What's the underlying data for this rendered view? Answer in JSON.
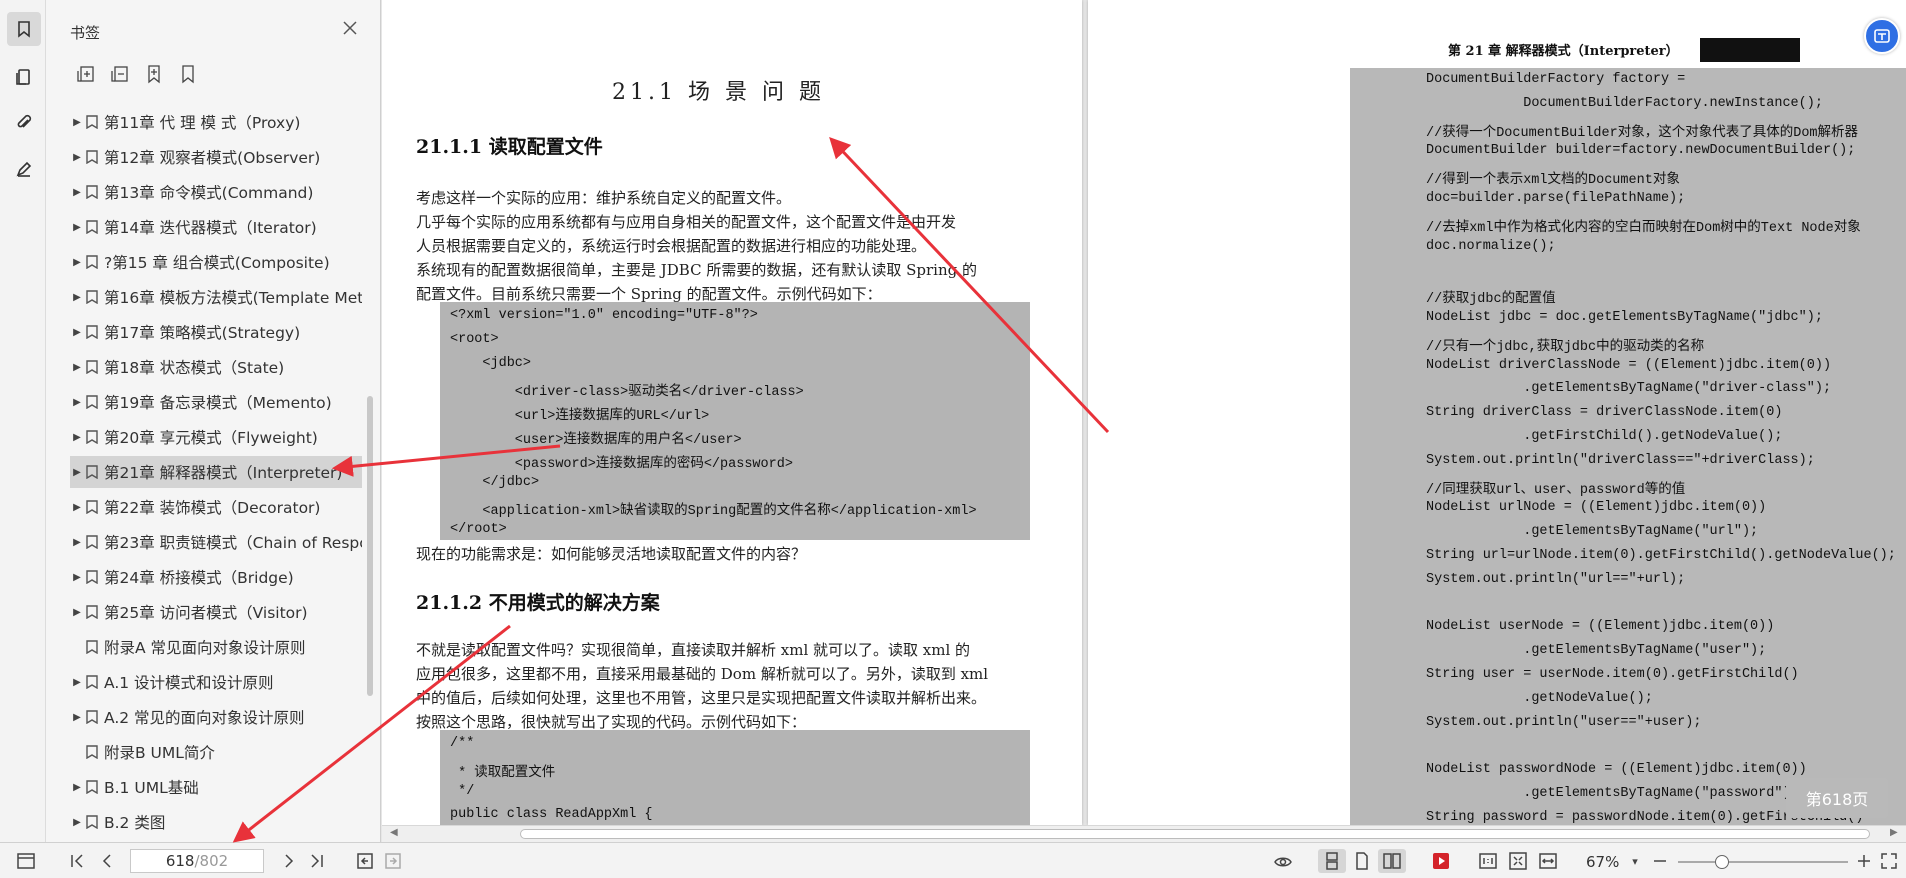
{
  "panel": {
    "title": "书签",
    "bookmarks": [
      {
        "label": "第11章 代 理 模 式（Proxy)",
        "expandable": true
      },
      {
        "label": "第12章 观察者模式(Observer)",
        "expandable": true
      },
      {
        "label": "第13章 命令模式(Command)",
        "expandable": true
      },
      {
        "label": "第14章 迭代器模式（Iterator)",
        "expandable": true
      },
      {
        "label": "?第15 章 组合模式(Composite)",
        "expandable": true
      },
      {
        "label": "第16章 模板方法模式(Template Met",
        "expandable": true
      },
      {
        "label": "第17章 策略模式(Strategy)",
        "expandable": true
      },
      {
        "label": "第18章 状态模式（State)",
        "expandable": true
      },
      {
        "label": "第19章 备忘录模式（Memento)",
        "expandable": true
      },
      {
        "label": "第20章 享元模式（Flyweight)",
        "expandable": true
      },
      {
        "label": "第21章 解释器模式（Interpreter)",
        "expandable": true,
        "selected": true
      },
      {
        "label": "第22章 装饰模式（Decorator)",
        "expandable": true
      },
      {
        "label": "第23章 职责链模式（Chain of Respc",
        "expandable": true
      },
      {
        "label": "第24章 桥接模式（Bridge)",
        "expandable": true
      },
      {
        "label": "第25章 访问者模式（Visitor)",
        "expandable": true
      },
      {
        "label": "附录A 常见面向对象设计原则",
        "expandable": false
      },
      {
        "label": "A.1 设计模式和设计原则",
        "expandable": true
      },
      {
        "label": "A.2 常见的面向对象设计原则",
        "expandable": true
      },
      {
        "label": "附录B UML简介",
        "expandable": false
      },
      {
        "label": "B.1 UML基础",
        "expandable": true
      },
      {
        "label": "B.2 类图",
        "expandable": true
      }
    ]
  },
  "left_page": {
    "section_title": "21.1  场 景 问 题",
    "sub1": "21.1.1   读取配置文件",
    "paras1": [
      "    考虑这样一个实际的应用：维护系统自定义的配置文件。",
      "    几乎每个实际的应用系统都有与应用自身相关的配置文件，这个配置文件是由开发",
      "人员根据需要自定义的，系统运行时会根据配置的数据进行相应的功能处理。",
      "    系统现有的配置数据很简单，主要是 JDBC 所需要的数据，还有默认读取 Spring 的",
      "配置文件。目前系统只需要一个 Spring 的配置文件。示例代码如下："
    ],
    "code1": [
      "<?xml version=\"1.0\" encoding=\"UTF-8\"?>",
      "<root>",
      "    <jdbc>",
      "        <driver-class>驱动类名</driver-class>",
      "        <url>连接数据库的URL</url>",
      "        <user>连接数据库的用户名</user>",
      "        <password>连接数据库的密码</password>",
      "    </jdbc>",
      "    <application-xml>缺省读取的Spring配置的文件名称</application-xml>",
      "</root>"
    ],
    "para_after_code1": "    现在的功能需求是：如何能够灵活地读取配置文件的内容？",
    "sub2": "21.1.2   不用模式的解决方案",
    "paras2": [
      "    不就是读取配置文件吗？实现很简单，直接读取并解析 xml 就可以了。读取 xml 的",
      "应用包很多，这里都不用，直接采用最基础的  Dom  解析就可以了。另外，读取到  xml",
      "中的值后，后续如何处理，这里也不用管，这里只是实现把配置文件读取并解析出来。",
      "    按照这个思路，很快就写出了实现的代码。示例代码如下："
    ],
    "code2": [
      "/**",
      " * 读取配置文件",
      " */",
      "public class ReadAppXml {"
    ]
  },
  "right_page": {
    "header": "第 21 章   解释器模式（Interpreter）",
    "code": [
      "DocumentBuilderFactory factory =",
      "            DocumentBuilderFactory.newInstance();",
      "//获得一个DocumentBuilder对象，这个对象代表了具体的Dom解析器",
      "DocumentBuilder builder=factory.newDocumentBuilder();",
      "//得到一个表示xml文档的Document对象",
      "doc=builder.parse(filePathName);",
      "//去掉xml中作为格式化内容的空白而映射在Dom树中的Text Node对象",
      "doc.normalize();",
      "",
      "//获取jdbc的配置值",
      "NodeList jdbc = doc.getElementsByTagName(\"jdbc\");",
      "//只有一个jdbc,获取jdbc中的驱动类的名称",
      "NodeList driverClassNode = ((Element)jdbc.item(0))",
      "            .getElementsByTagName(\"driver-class\");",
      "String driverClass = driverClassNode.item(0)",
      "            .getFirstChild().getNodeValue();",
      "System.out.println(\"driverClass==\"+driverClass);",
      "//同理获取url、user、password等的值",
      "NodeList urlNode = ((Element)jdbc.item(0))",
      "            .getElementsByTagName(\"url\");",
      "String url=urlNode.item(0).getFirstChild().getNodeValue();",
      "System.out.println(\"url==\"+url);",
      "",
      "NodeList userNode = ((Element)jdbc.item(0))",
      "            .getElementsByTagName(\"user\");",
      "String user = userNode.item(0).getFirstChild()",
      "            .getNodeValue();",
      "System.out.println(\"user==\"+user);",
      "",
      "NodeList passwordNode = ((Element)jdbc.item(0))",
      "            .getElementsByTagName(\"password\");",
      "String password = passwordNode.item(0).getFirstChild()"
    ]
  },
  "page_badge": "第618页",
  "toolbar": {
    "current_page": "618",
    "total_pages": "/802",
    "zoom": "67%",
    "zoom_fraction": 0.26
  },
  "colors": {
    "annotation_arrow": "#e8323a",
    "accent": "#2f6fe4"
  }
}
